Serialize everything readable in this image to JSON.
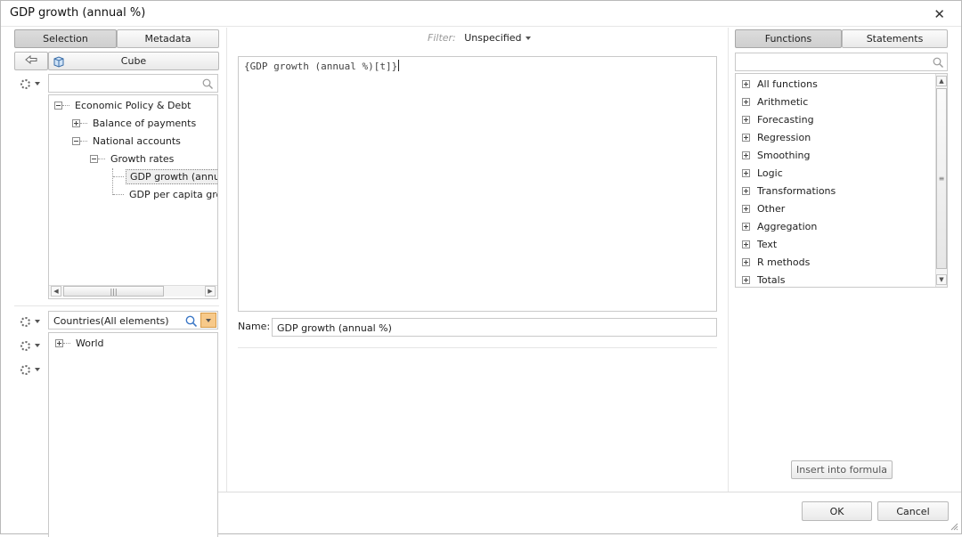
{
  "window": {
    "title": "GDP growth (annual %)"
  },
  "left": {
    "tabs": [
      {
        "label": "Selection",
        "active": true
      },
      {
        "label": "Metadata",
        "active": false
      }
    ],
    "cube_label": "Cube",
    "tree": [
      {
        "label": "Economic Policy & Debt",
        "level": 0,
        "expander": "minus"
      },
      {
        "label": "Balance of payments",
        "level": 1,
        "expander": "plus"
      },
      {
        "label": "National accounts",
        "level": 1,
        "expander": "minus"
      },
      {
        "label": "Growth rates",
        "level": 2,
        "expander": "minus"
      },
      {
        "label": "GDP growth (annual",
        "level": 3,
        "expander": "none",
        "selected": true
      },
      {
        "label": "GDP per capita grow",
        "level": 3,
        "expander": "none"
      }
    ],
    "dimension_value": "Countries(All elements)",
    "dimension_tree": [
      {
        "label": "World",
        "expander": "plus"
      }
    ]
  },
  "center": {
    "filter_label": "Filter:",
    "filter_value": "Unspecified",
    "formula": "{GDP growth (annual %)[t]}",
    "name_label": "Name:",
    "name_value": "GDP growth (annual %)"
  },
  "right": {
    "tabs": [
      {
        "label": "Functions",
        "active": true
      },
      {
        "label": "Statements",
        "active": false
      }
    ],
    "functions": [
      "All functions",
      "Arithmetic",
      "Forecasting",
      "Regression",
      "Smoothing",
      "Logic",
      "Transformations",
      "Other",
      "Aggregation",
      "Text",
      "R methods",
      "Totals"
    ],
    "insert_label": "Insert into formula"
  },
  "footer": {
    "ok_label": "OK",
    "cancel_label": "Cancel"
  },
  "colors": {
    "active_tab": "#d4d4d4",
    "border": "#c9c9c9",
    "dropdown_highlight": "#f7c98a"
  }
}
